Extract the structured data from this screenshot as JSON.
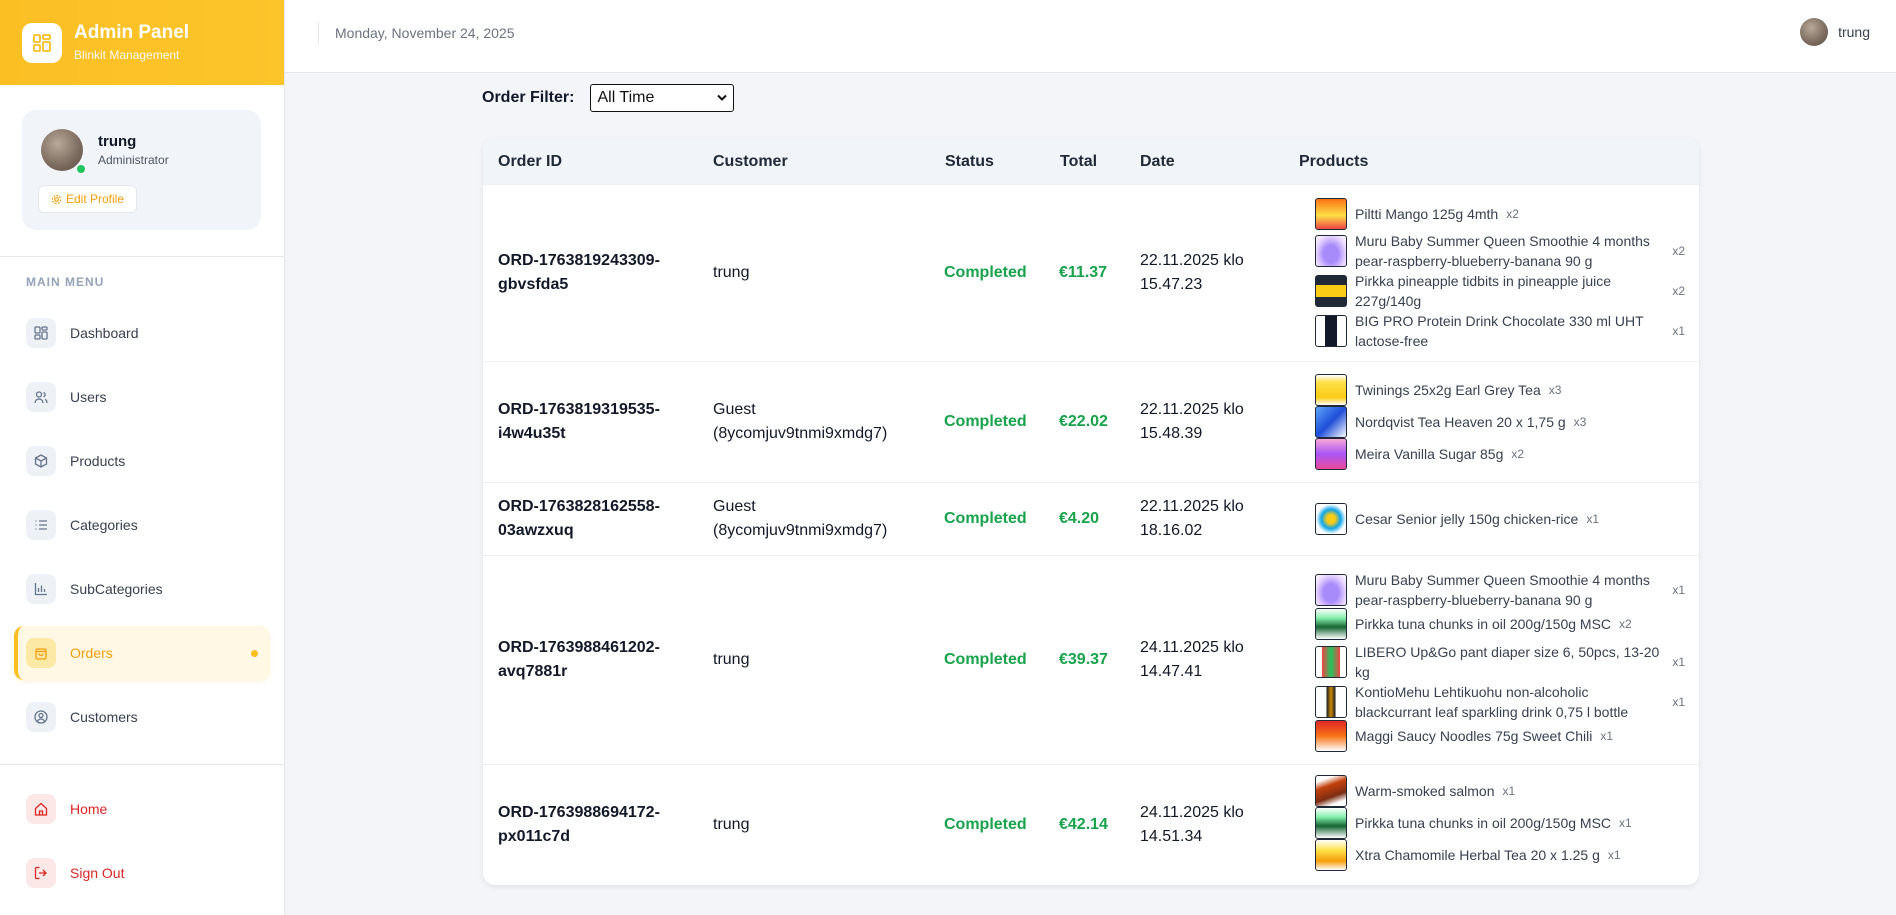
{
  "brand": {
    "title": "Admin Panel",
    "subtitle": "Blinkit Management"
  },
  "profile": {
    "name": "trung",
    "role": "Administrator",
    "edit_label": "Edit Profile"
  },
  "menu": {
    "heading": "MAIN MENU",
    "items": [
      {
        "label": "Dashboard"
      },
      {
        "label": "Users"
      },
      {
        "label": "Products"
      },
      {
        "label": "Categories"
      },
      {
        "label": "SubCategories"
      },
      {
        "label": "Orders"
      },
      {
        "label": "Customers"
      }
    ],
    "bottom": [
      {
        "label": "Home"
      },
      {
        "label": "Sign Out"
      }
    ]
  },
  "header": {
    "date": "Monday, November 24, 2025",
    "username": "trung"
  },
  "filter": {
    "label": "Order Filter:",
    "selected": "All Time"
  },
  "table": {
    "headers": [
      "Order ID",
      "Customer",
      "Status",
      "Total",
      "Date",
      "Products"
    ],
    "rows": [
      {
        "id": "ORD-1763819243309-gbvsfda5",
        "customer": "trung",
        "status": "Completed",
        "total": "€11.37",
        "date": "22.11.2025 klo 15.47.23",
        "products": [
          {
            "name": "Piltti Mango 125g 4mth",
            "qty": "x2"
          },
          {
            "name": "Muru Baby Summer Queen Smoothie 4 months pear-raspberry-blueberry-banana 90 g",
            "qty": "x2"
          },
          {
            "name": "Pirkka pineapple tidbits in pineapple juice 227g/140g",
            "qty": "x2"
          },
          {
            "name": "BIG PRO Protein Drink Chocolate 330 ml UHT lactose-free",
            "qty": "x1"
          }
        ]
      },
      {
        "id": "ORD-1763819319535-i4w4u35t",
        "customer": "Guest (8ycomjuv9tnmi9xmdg7)",
        "status": "Completed",
        "total": "€22.02",
        "date": "22.11.2025 klo 15.48.39",
        "products": [
          {
            "name": "Twinings 25x2g Earl Grey Tea",
            "qty": "x3"
          },
          {
            "name": "Nordqvist Tea Heaven 20 x 1,75 g",
            "qty": "x3"
          },
          {
            "name": "Meira Vanilla Sugar 85g",
            "qty": "x2"
          }
        ]
      },
      {
        "id": "ORD-1763828162558-03awzxuq",
        "customer": "Guest (8ycomjuv9tnmi9xmdg7)",
        "status": "Completed",
        "total": "€4.20",
        "date": "22.11.2025 klo 18.16.02",
        "products": [
          {
            "name": "Cesar Senior jelly 150g chicken-rice",
            "qty": "x1"
          }
        ]
      },
      {
        "id": "ORD-1763988461202-avq7881r",
        "customer": "trung",
        "status": "Completed",
        "total": "€39.37",
        "date": "24.11.2025 klo 14.47.41",
        "products": [
          {
            "name": "Muru Baby Summer Queen Smoothie 4 months pear-raspberry-blueberry-banana 90 g",
            "qty": "x1"
          },
          {
            "name": "Pirkka tuna chunks in oil 200g/150g MSC",
            "qty": "x2"
          },
          {
            "name": "LIBERO Up&Go pant diaper size 6, 50pcs, 13-20 kg",
            "qty": "x1"
          },
          {
            "name": "KontioMehu Lehtikuohu non-alcoholic blackcurrant leaf sparkling drink 0,75 l bottle",
            "qty": "x1"
          },
          {
            "name": "Maggi Saucy Noodles 75g Sweet Chili",
            "qty": "x1"
          }
        ]
      },
      {
        "id": "ORD-1763988694172-px011c7d",
        "customer": "trung",
        "status": "Completed",
        "total": "€42.14",
        "date": "24.11.2025 klo 14.51.34",
        "products": [
          {
            "name": "Warm-smoked salmon",
            "qty": "x1"
          },
          {
            "name": "Pirkka tuna chunks in oil 200g/150g MSC",
            "qty": "x1"
          },
          {
            "name": "Xtra Chamomile Herbal Tea 20 x 1.25 g",
            "qty": "x1"
          }
        ]
      }
    ]
  },
  "colors": {
    "accent": "#fbbf24",
    "success": "#16a34a",
    "danger": "#dc2626"
  },
  "icons": {
    "brand": "dashboard-grid-icon",
    "edit": "gear-icon",
    "menu": [
      "grid-icon",
      "users-icon",
      "box-icon",
      "list-icon",
      "bar-chart-icon",
      "bag-icon",
      "user-circle-icon"
    ],
    "bottom": [
      "house-icon",
      "logout-icon"
    ],
    "select": "chevron-down-icon"
  }
}
